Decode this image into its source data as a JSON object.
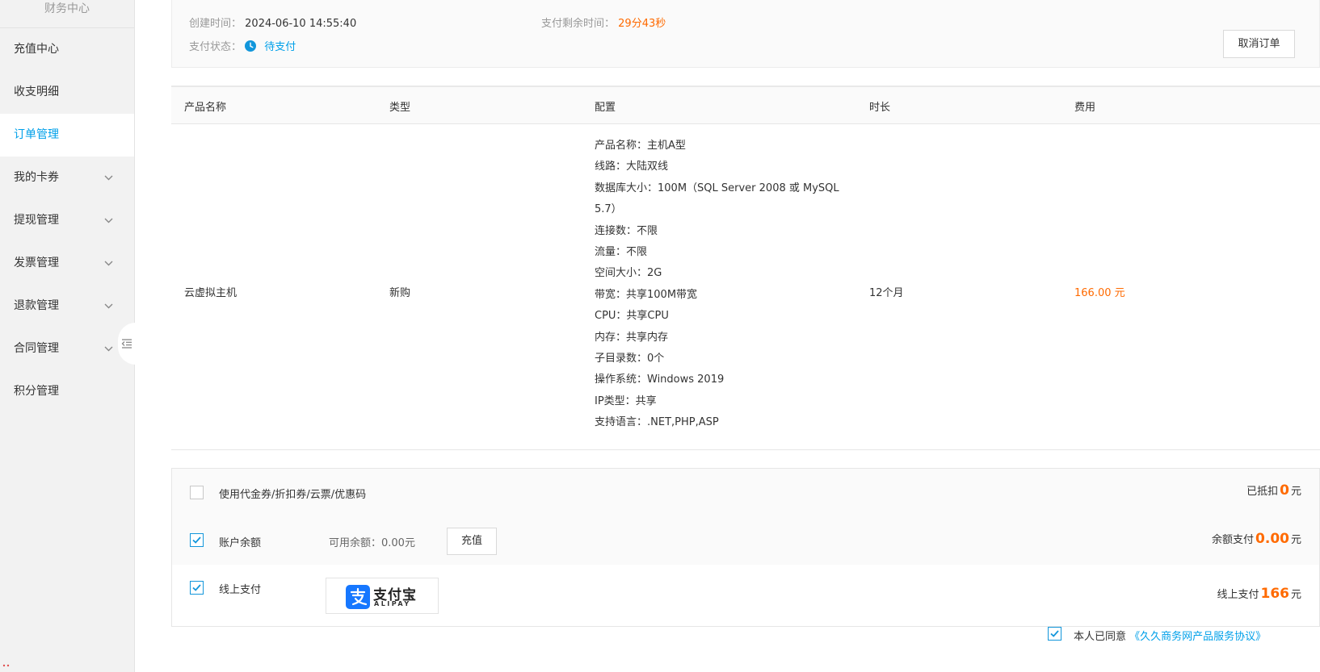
{
  "sidebar": {
    "title": "财务中心",
    "items": [
      {
        "label": "充值中心",
        "has_submenu": false,
        "active": false
      },
      {
        "label": "收支明细",
        "has_submenu": false,
        "active": false
      },
      {
        "label": "订单管理",
        "has_submenu": false,
        "active": true
      },
      {
        "label": "我的卡券",
        "has_submenu": true,
        "active": false
      },
      {
        "label": "提现管理",
        "has_submenu": true,
        "active": false
      },
      {
        "label": "发票管理",
        "has_submenu": true,
        "active": false
      },
      {
        "label": "退款管理",
        "has_submenu": true,
        "active": false
      },
      {
        "label": "合同管理",
        "has_submenu": true,
        "active": false
      },
      {
        "label": "积分管理",
        "has_submenu": false,
        "active": false
      }
    ]
  },
  "order": {
    "created_label": "创建时间：",
    "created_value": "2024-06-10 14:55:40",
    "remaining_label": "支付剩余时间：",
    "remaining_value": "29分43秒",
    "status_label": "支付状态：",
    "status_value": "待支付",
    "cancel_label": "取消订单"
  },
  "table": {
    "headers": [
      "产品名称",
      "类型",
      "配置",
      "时长",
      "费用"
    ],
    "row": {
      "product": "云虚拟主机",
      "type": "新购",
      "config": [
        "产品名称：主机A型",
        "线路：大陆双线",
        "数据库大小：100M（SQL Server 2008 或 MySQL 5.7）",
        "连接数：不限",
        "流量：不限",
        "空间大小：2G",
        "带宽：共享100M带宽",
        "CPU：共享CPU",
        "内存：共享内存",
        "子目录数：0个",
        "操作系统：Windows 2019",
        "IP类型：共享",
        "支持语言：.NET,PHP,ASP"
      ],
      "duration": "12个月",
      "fee": "166.00 元"
    }
  },
  "payment": {
    "coupon": {
      "label": "使用代金券/折扣券/云票/优惠码",
      "checked": false,
      "right_label": "已抵扣",
      "amount": "0",
      "unit": "元"
    },
    "balance": {
      "label": "账户余额",
      "checked": true,
      "available": "可用余额：0.00元",
      "recharge_label": "充值",
      "right_label": "余额支付",
      "amount": "0.00",
      "unit": "元"
    },
    "online": {
      "label": "线上支付",
      "checked": true,
      "method_name": "支付宝",
      "method_en": "ALIPAY",
      "right_label": "线上支付",
      "amount": "166",
      "unit": "元"
    }
  },
  "agreement": {
    "checked": true,
    "text": "本人已同意",
    "link": "《久久商务网产品服务协议》"
  },
  "colors": {
    "accent": "#00a0e9",
    "price": "#ff6a00",
    "checkbox": "#1296db",
    "alipay_blue": "#1677ff"
  }
}
